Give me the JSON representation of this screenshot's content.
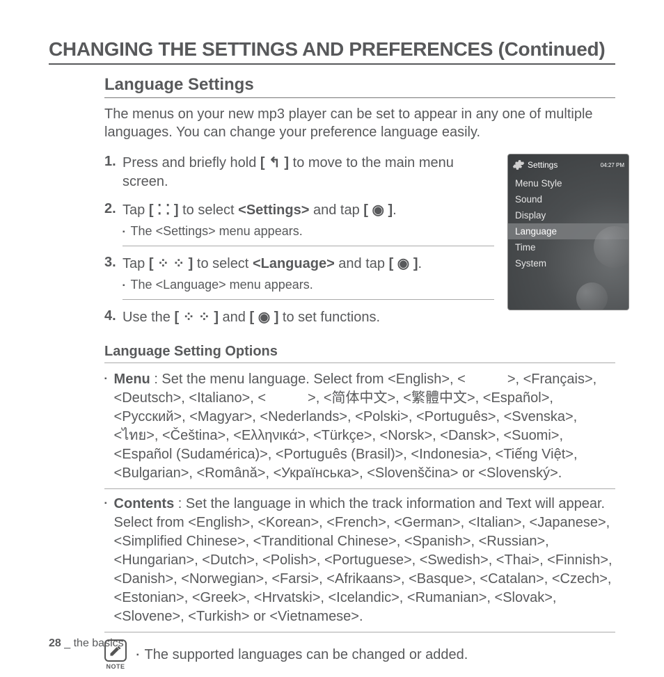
{
  "header": {
    "title": "CHANGING THE SETTINGS AND PREFERENCES (Continued)"
  },
  "section": {
    "title": "Language Settings",
    "intro": "The menus on your new mp3 player can be set to appear in any one of multiple languages. You can change your preference language easily."
  },
  "steps": [
    {
      "num": "1.",
      "text_before": "Press and briefly hold ",
      "icon_token": "[ ↰ ]",
      "text_after": " to move to the main menu screen."
    },
    {
      "num": "2.",
      "tap_prefix": "Tap ",
      "dirs_icon": "[ ⁚ ⁚ ]",
      "tap_mid": " to select ",
      "target": "<Settings>",
      "tap_and": " and tap ",
      "ok_icon": "[ ◉ ]",
      "tap_end": ".",
      "sub": "The <Settings> menu appears."
    },
    {
      "num": "3.",
      "tap_prefix": "Tap ",
      "dirs_icon": "[ ⁘ ⁘ ]",
      "tap_mid": " to select ",
      "target": "<Language>",
      "tap_and": " and tap ",
      "ok_icon": "[ ◉ ]",
      "tap_end": ".",
      "sub": "The <Language> menu appears."
    },
    {
      "num": "4.",
      "text_before": "Use the ",
      "dirs_icon": "[ ⁘ ⁘ ]",
      "text_mid": " and ",
      "ok_icon": "[ ◉ ]",
      "text_after": " to set functions."
    }
  ],
  "options_title": "Language Setting Options",
  "options": {
    "menu": {
      "label": "Menu",
      "body": " : Set the menu language. Select from <English>, <　　　>, <Français>, <Deutsch>, <Italiano>, <　　　>, <简体中文>, <繁體中文>, <Español>, <Русский>, <Magyar>, <Nederlands>, <Polski>, <Português>, <Svenska>, <ไทย>, <Čeština>, <Ελληνικά>, <Türkçe>, <Norsk>, <Dansk>, <Suomi>, <Español (Sudamérica)>, <Português (Brasil)>, <Indonesia>, <Tiếng Việt>, <Bulgarian>, <Română>, <Українська>, <Slovenščina> or <Slovenský>."
    },
    "contents": {
      "label": "Contents",
      "body": " : Set the language in which the track information and Text will appear. Select from <English>, <Korean>, <French>, <German>, <Italian>, <Japanese>, <Simplified Chinese>, <Tranditional Chinese>, <Spanish>, <Russian>, <Hungarian>, <Dutch>, <Polish>, <Portuguese>, <Swedish>, <Thai>, <Finnish>, <Danish>, <Norwegian>, <Farsi>, <Afrikaans>, <Basque>, <Catalan>, <Czech>, <Estonian>, <Greek>, <Hrvatski>, <Icelandic>, <Rumanian>, <Slovak>, <Slovene>, <Turkish> or <Vietnamese>."
    }
  },
  "note": {
    "icon_label": "NOTE",
    "text": "The supported languages can be changed or added."
  },
  "footer": {
    "page_num": "28",
    "sep": " _ ",
    "section": "the basics"
  },
  "device": {
    "title": "Settings",
    "time": "04:27 PM",
    "menu": [
      {
        "label": "Menu Style",
        "selected": false
      },
      {
        "label": "Sound",
        "selected": false
      },
      {
        "label": "Display",
        "selected": false
      },
      {
        "label": "Language",
        "selected": true
      },
      {
        "label": "Time",
        "selected": false
      },
      {
        "label": "System",
        "selected": false
      }
    ]
  }
}
